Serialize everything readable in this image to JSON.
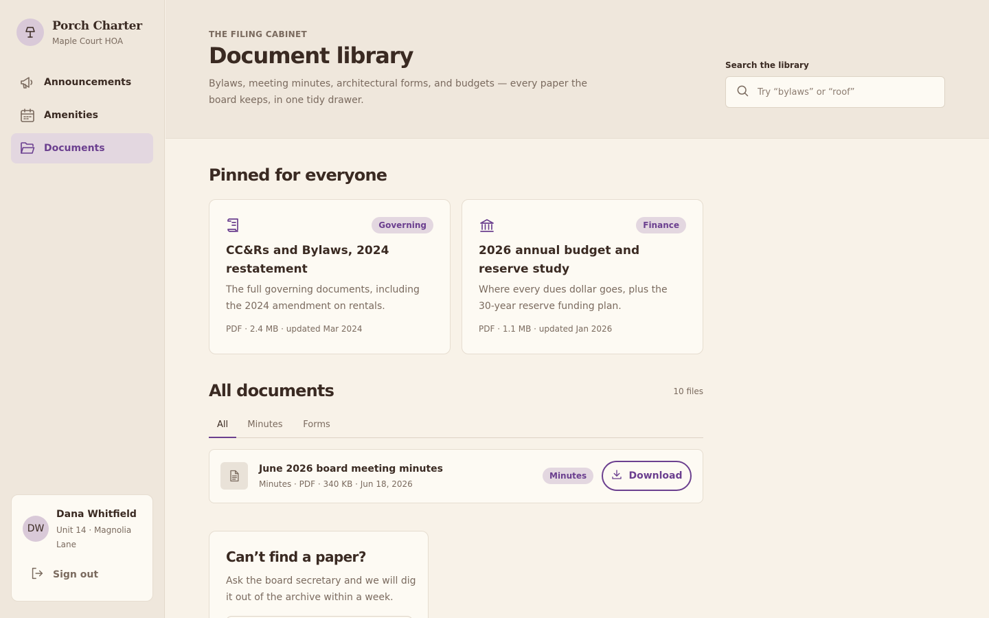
{
  "brand": {
    "title": "Porch Charter",
    "subtitle": "Maple Court HOA",
    "logo_icon": "lamp-icon"
  },
  "nav": {
    "items": [
      {
        "label": "Announcements",
        "icon": "megaphone-icon",
        "active": false
      },
      {
        "label": "Amenities",
        "icon": "calendar-icon",
        "active": false
      },
      {
        "label": "Documents",
        "icon": "folder-open-icon",
        "active": true
      }
    ]
  },
  "user": {
    "initials": "DW",
    "name": "Dana Whitfield",
    "unit": "Unit 14 · Magnolia Lane",
    "signout_label": "Sign out"
  },
  "header": {
    "eyebrow": "THE FILING CABINET",
    "title": "Document library",
    "description": "Bylaws, meeting minutes, architectural forms, and budgets — every paper the board keeps, in one tidy drawer."
  },
  "search": {
    "label": "Search the library",
    "placeholder": "Try “bylaws” or “roof”",
    "value": ""
  },
  "pinned": {
    "title": "Pinned for everyone",
    "cards": [
      {
        "icon": "scroll-icon",
        "tag": "Governing",
        "title": "CC&Rs and Bylaws, 2024 restatement",
        "description": "The full governing documents, including the 2024 amendment on rentals.",
        "meta": "PDF · 2.4 MB · updated Mar 2024"
      },
      {
        "icon": "bank-icon",
        "tag": "Finance",
        "title": "2026 annual budget and reserve study",
        "description": "Where every dues dollar goes, plus the 30-year reserve funding plan.",
        "meta": "PDF · 1.1 MB · updated Jan 2026"
      }
    ]
  },
  "all_docs": {
    "title": "All documents",
    "count": "10 files",
    "tabs": [
      {
        "label": "All",
        "active": true
      },
      {
        "label": "Minutes",
        "active": false
      },
      {
        "label": "Forms",
        "active": false
      }
    ],
    "rows": [
      {
        "icon": "file-text-icon",
        "title": "June 2026 board meeting minutes",
        "meta": "Minutes · PDF · 340 KB · Jun 18, 2026",
        "tag": "Minutes",
        "action": "Download"
      }
    ]
  },
  "help": {
    "title": "Can’t find a paper?",
    "description": "Ask the board secretary and we will dig it out of the archive within a week."
  },
  "colors": {
    "accent": "#6b3f8f",
    "accent_soft": "#e3d7e0",
    "sidebar_bg": "#efe7dc",
    "page_bg": "#f8f2e8",
    "card_bg": "#fdfaf3",
    "text": "#3a2a22",
    "muted": "#7a6a5e"
  }
}
